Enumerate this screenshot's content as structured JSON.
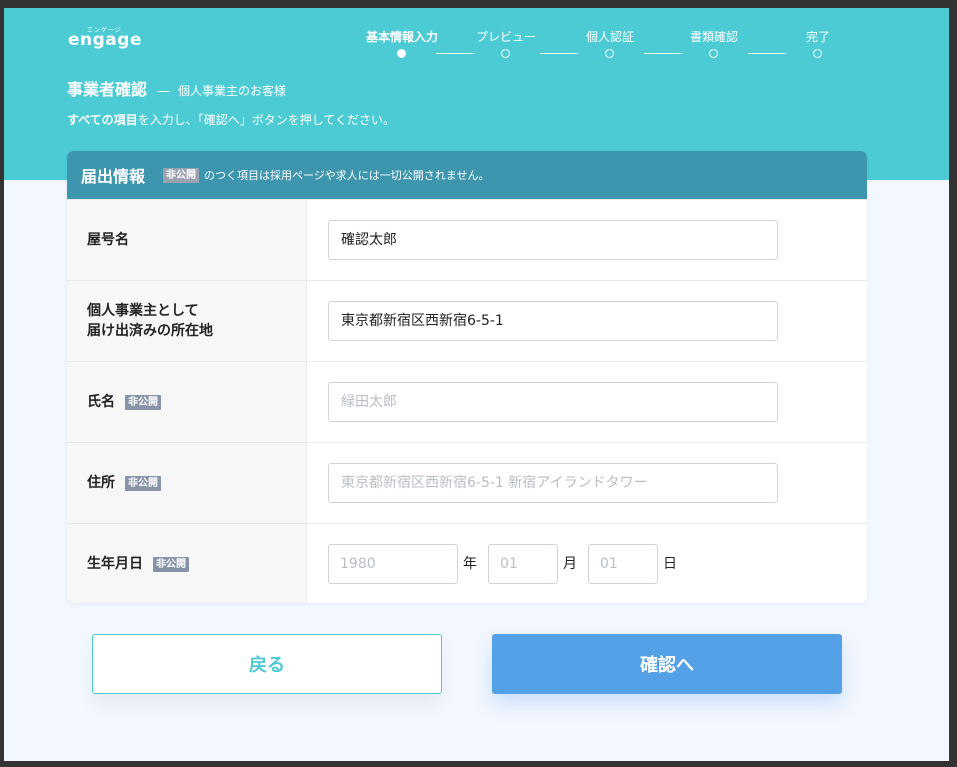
{
  "header": {
    "logo_text": "engage",
    "logo_ruby": "エンゲージ",
    "steps": [
      {
        "label": "基本情報入力",
        "active": true
      },
      {
        "label": "プレビュー",
        "active": false
      },
      {
        "label": "個人認証",
        "active": false
      },
      {
        "label": "書類確認",
        "active": false
      },
      {
        "label": "完了",
        "active": false
      }
    ],
    "title": "事業者確認",
    "title_dash": "—",
    "subtitle": "個人事業主のお客様",
    "instruction_bold": "すべての項目",
    "instruction_rest": "を入力し、「確認へ」ボタンを押してください。"
  },
  "form": {
    "heading": "届出情報",
    "private_badge": "非公開",
    "heading_note": "のつく項目は採用ページや求人には一切公開されません。",
    "rows": [
      {
        "label": "屋号名",
        "value": "確認太郎",
        "placeholder": ""
      },
      {
        "label_line1": "個人事業主として",
        "label_line2": "届け出済みの所在地",
        "value": "東京都新宿区西新宿6-5-1",
        "placeholder": ""
      },
      {
        "label": "氏名",
        "badge": "非公開",
        "value": "",
        "placeholder": "緑田太郎"
      },
      {
        "label": "住所",
        "badge": "非公開",
        "value": "",
        "placeholder": "東京都新宿区西新宿6-5-1 新宿アイランドタワー"
      },
      {
        "label": "生年月日",
        "badge": "非公開"
      }
    ],
    "dob": {
      "year_placeholder": "1980",
      "year_unit": "年",
      "month_placeholder": "01",
      "month_unit": "月",
      "day_placeholder": "01",
      "day_unit": "日"
    }
  },
  "buttons": {
    "back_label": "戻る",
    "confirm_label": "確認へ"
  },
  "colors": {
    "hero": "#4ccbd5",
    "card_header": "#3d95ae",
    "confirm": "#54a1e8",
    "badge": "#8794a8"
  }
}
